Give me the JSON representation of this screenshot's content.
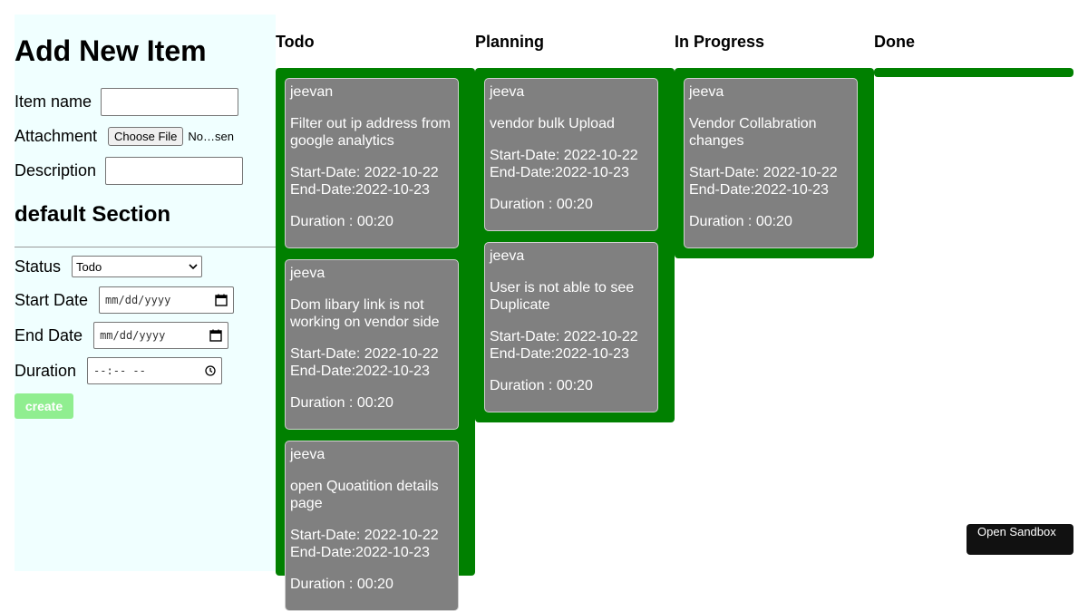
{
  "form": {
    "title": "Add New Item",
    "item_name_label": "Item name",
    "item_name_value": "",
    "attachment_label": "Attachment",
    "choose_file_label": "Choose File",
    "file_status": "No…sen",
    "description_label": "Description",
    "description_value": "",
    "section_title": "default Section",
    "status_label": "Status",
    "status_value": "Todo",
    "start_date_label": "Start Date",
    "start_date_placeholder": "mm/dd/yyyy",
    "end_date_label": "End Date",
    "end_date_placeholder": "mm/dd/yyyy",
    "duration_label": "Duration",
    "duration_placeholder": "--:-- --",
    "create_label": "create"
  },
  "icons": {
    "select": "chevron-down-icon",
    "date": "calendar-icon",
    "time": "clock-icon"
  },
  "colors": {
    "sidebar_bg": "#f0ffff",
    "column_bg": "#008000",
    "card_bg": "#808080",
    "create_button_bg": "#90ee90"
  },
  "board": {
    "columns": [
      {
        "title": "Todo",
        "cards": [
          {
            "user": "jeevan",
            "title": "Filter out ip address from google analytics",
            "start": "Start-Date: 2022-10-22",
            "end": "End-Date:2022-10-23",
            "duration": "Duration : 00:20"
          },
          {
            "user": "jeeva",
            "title": "Dom libary link is not working on vendor side",
            "start": "Start-Date: 2022-10-22",
            "end": "End-Date:2022-10-23",
            "duration": "Duration : 00:20"
          },
          {
            "user": "jeeva",
            "title": "open Quoatition details page",
            "start": "Start-Date: 2022-10-22",
            "end": "End-Date:2022-10-23",
            "duration": "Duration : 00:20"
          }
        ]
      },
      {
        "title": "Planning",
        "cards": [
          {
            "user": "jeeva",
            "title": "vendor bulk Upload",
            "start": "Start-Date: 2022-10-22",
            "end": "End-Date:2022-10-23",
            "duration": "Duration : 00:20"
          },
          {
            "user": "jeeva",
            "title": "User is not able to see Duplicate",
            "start": "Start-Date: 2022-10-22",
            "end": "End-Date:2022-10-23",
            "duration": "Duration : 00:20"
          }
        ]
      },
      {
        "title": "In Progress",
        "cards": [
          {
            "user": "jeeva",
            "title": "Vendor Collabration changes",
            "start": "Start-Date: 2022-10-22",
            "end": "End-Date:2022-10-23",
            "duration": "Duration : 00:20"
          }
        ]
      },
      {
        "title": "Done",
        "cards": []
      }
    ]
  },
  "sandbox_label": "Open Sandbox"
}
